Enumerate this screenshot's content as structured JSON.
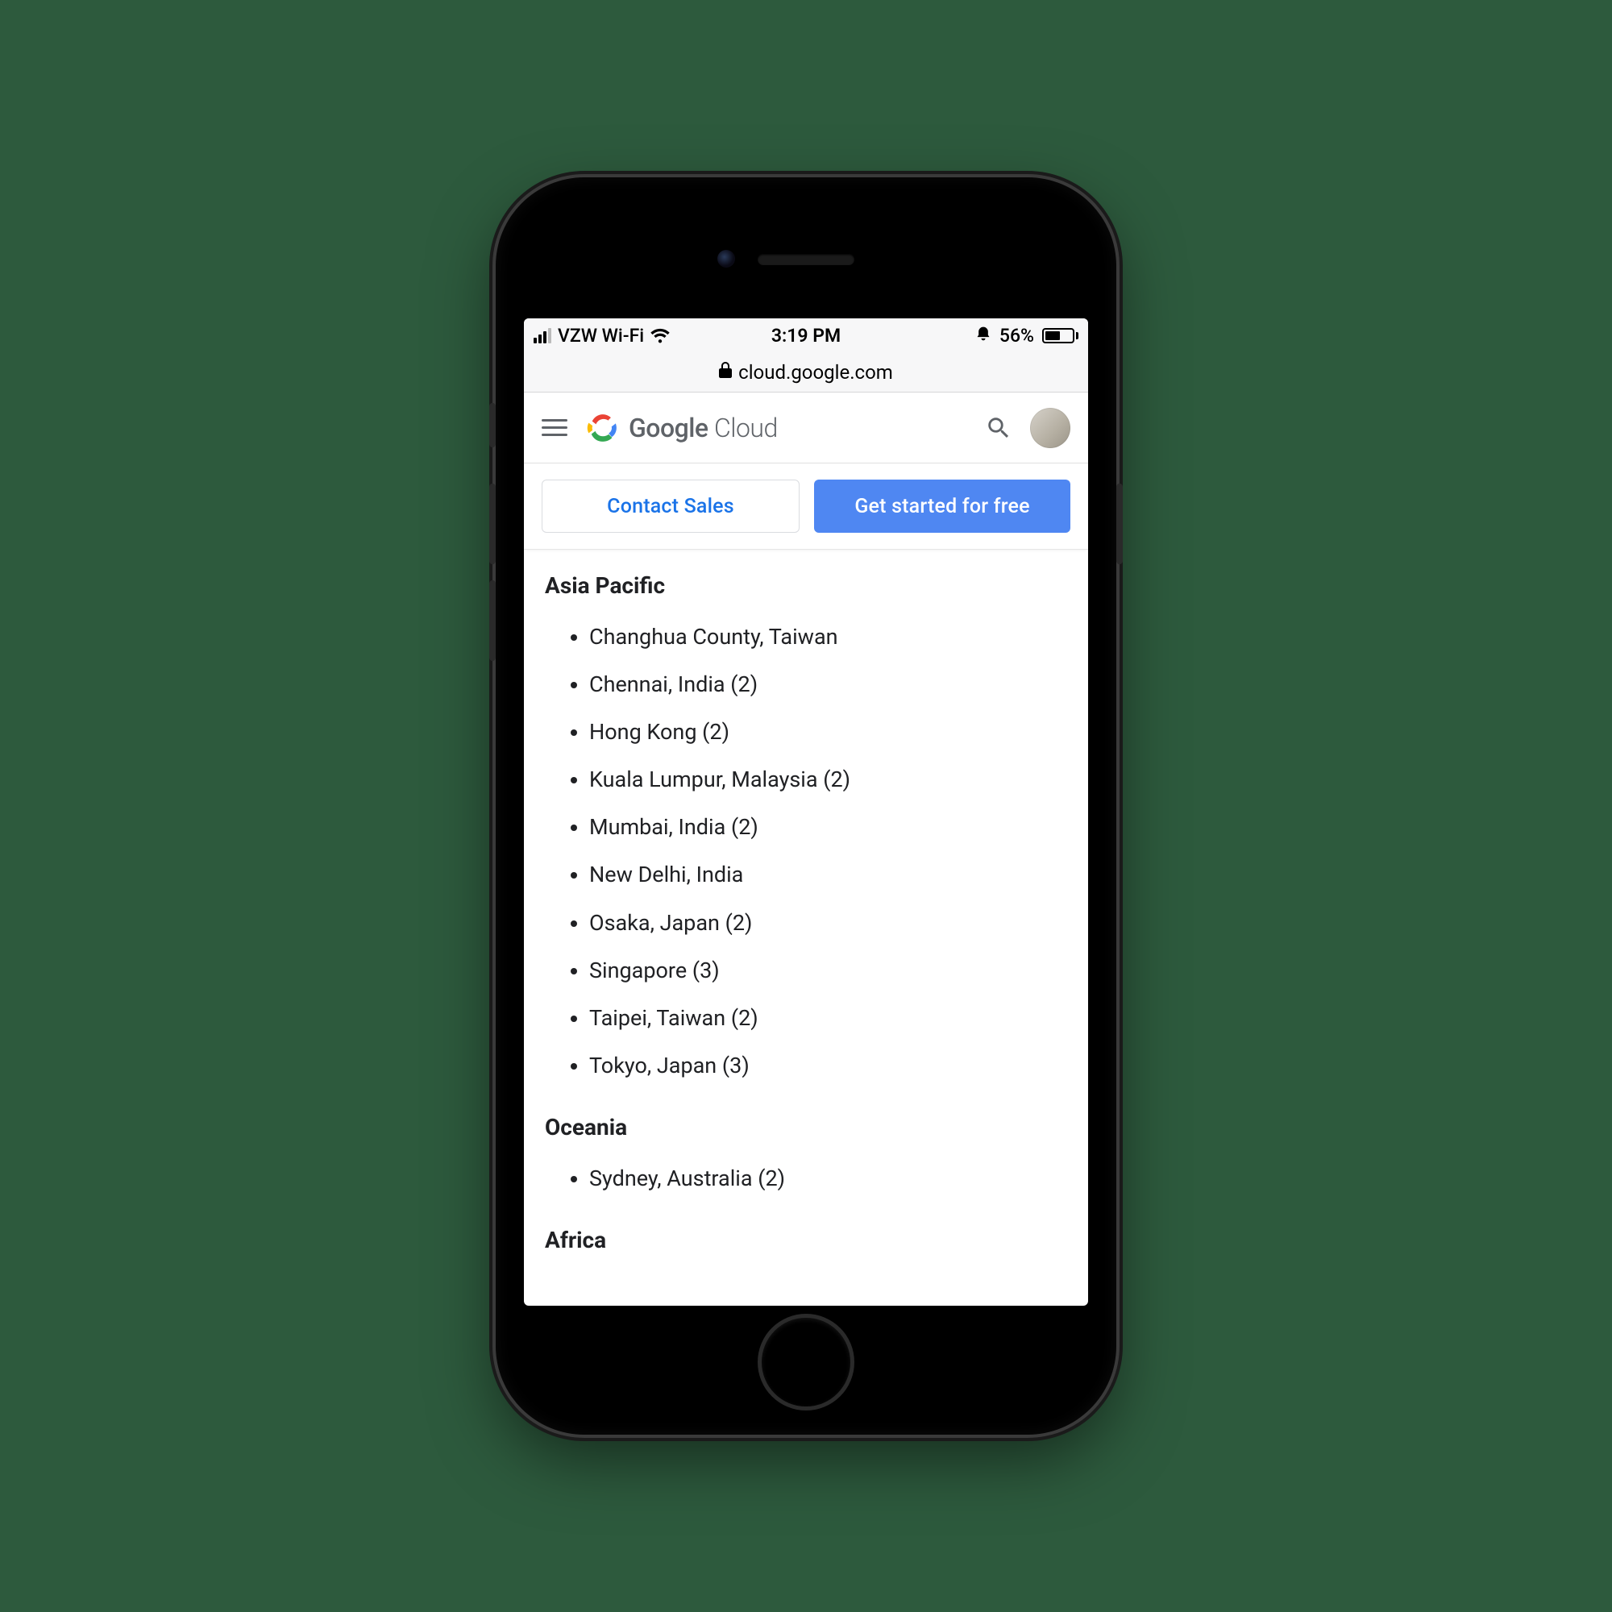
{
  "statusbar": {
    "carrier": "VZW Wi-Fi",
    "time": "3:19 PM",
    "battery_pct": "56%"
  },
  "browser": {
    "domain": "cloud.google.com"
  },
  "header": {
    "brand_bold": "Google",
    "brand_light": "Cloud"
  },
  "cta": {
    "contact": "Contact Sales",
    "start": "Get started for free"
  },
  "regions": [
    {
      "title": "Asia Pacific",
      "items": [
        "Changhua County, Taiwan",
        "Chennai, India (2)",
        "Hong Kong (2)",
        "Kuala Lumpur, Malaysia (2)",
        "Mumbai, India (2)",
        "New Delhi, India",
        "Osaka, Japan (2)",
        "Singapore (3)",
        "Taipei, Taiwan (2)",
        "Tokyo, Japan (3)"
      ]
    },
    {
      "title": "Oceania",
      "items": [
        "Sydney, Australia (2)"
      ]
    },
    {
      "title": "Africa",
      "items": []
    }
  ]
}
